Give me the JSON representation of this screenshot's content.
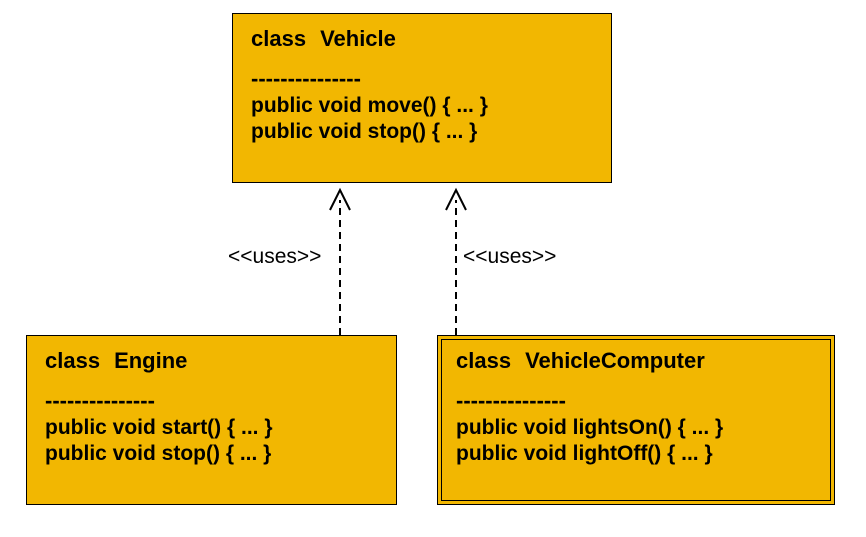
{
  "boxes": {
    "vehicle": {
      "title_keyword": "class",
      "title_name": "Vehicle",
      "divider": "---------------",
      "methods": [
        "public void move() { ... }",
        "public void stop() { ... }"
      ]
    },
    "engine": {
      "title_keyword": "class",
      "title_name": "Engine",
      "divider": "---------------",
      "methods": [
        "public void start() { ... }",
        "public void stop() { ... }"
      ]
    },
    "computer": {
      "title_keyword": "class",
      "title_name": "VehicleComputer",
      "divider": "---------------",
      "methods": [
        "public void lightsOn() { ... }",
        "public void lightOff() { ... }"
      ]
    }
  },
  "relations": {
    "left": "<<uses>>",
    "right": "<<uses>>"
  }
}
